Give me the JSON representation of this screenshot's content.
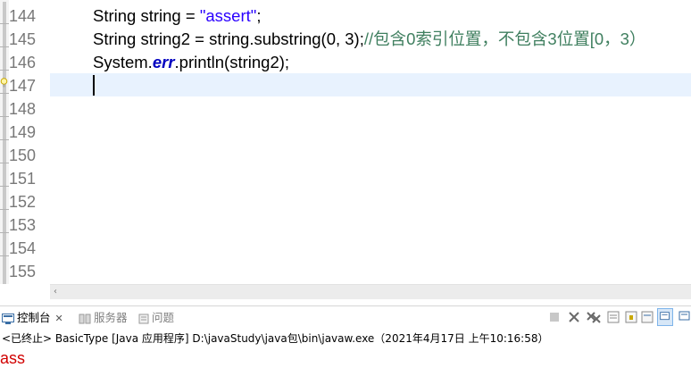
{
  "editor": {
    "line_numbers": [
      "144",
      "145",
      "146",
      "147",
      "148",
      "149",
      "150",
      "151",
      "152",
      "153",
      "154",
      "155"
    ],
    "code": {
      "line144": {
        "type": "String",
        "var": "string",
        "assign": " = ",
        "literal": "\"assert\"",
        "end": ";"
      },
      "line145": {
        "type": "String",
        "var": "string2",
        "assign": " = ",
        "call": "string.substring(0, 3);",
        "comment": "//包含0索引位置，不包含3位置[0，3）"
      },
      "line146": {
        "prefix": "System.",
        "field": "err",
        "call": ".println(string2);"
      }
    }
  },
  "console": {
    "tabs": [
      {
        "label": "控制台",
        "icon": "console-icon",
        "active": true
      },
      {
        "label": "服务器",
        "icon": "servers-icon",
        "active": false
      },
      {
        "label": "问题",
        "icon": "problems-icon",
        "active": false
      }
    ],
    "header": "<已终止> BasicType [Java 应用程序] D:\\javaStudy\\java包\\bin\\javaw.exe（2021年4月17日 上午10:16:58）",
    "output": "ass"
  },
  "colors": {
    "string_literal": "#2a00ff",
    "comment": "#3f7f5f",
    "static_field": "#0000c0",
    "stderr": "#d10000",
    "current_line": "#e8f2fe"
  }
}
